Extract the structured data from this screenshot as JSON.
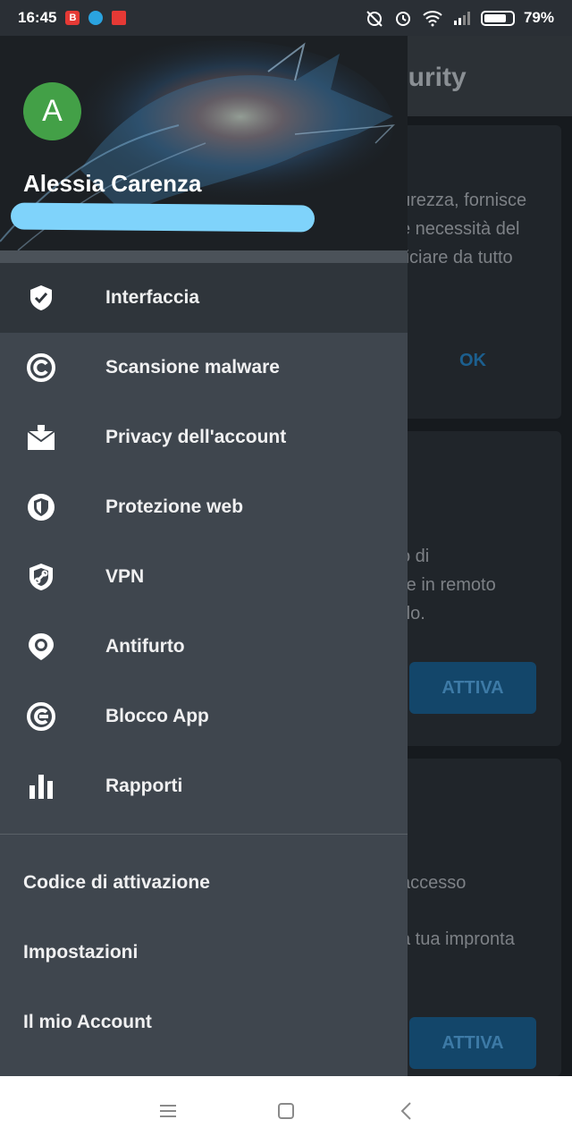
{
  "status_bar": {
    "time": "16:45",
    "notif_b": "B",
    "battery": "79%",
    "battery_level": 0.79
  },
  "background_app": {
    "title_partial": "curity",
    "card1_lines": [
      "urezza, fornisce",
      "e necessità del",
      "ficiare da tutto"
    ],
    "card1_button": "OK",
    "card2_lines": [
      "o di",
      "re in remoto",
      "rlo."
    ],
    "card2_button": "ATTIVA",
    "card3_lines": [
      "accesso",
      "a tua impronta"
    ],
    "card3_button": "ATTIVA"
  },
  "drawer": {
    "avatar_letter": "A",
    "user_name": "Alessia Carenza",
    "menu": [
      {
        "label": "Interfaccia",
        "icon": "shield-check-icon",
        "active": true
      },
      {
        "label": "Scansione malware",
        "icon": "scan-icon",
        "active": false
      },
      {
        "label": "Privacy dell'account",
        "icon": "mail-privacy-icon",
        "active": false
      },
      {
        "label": "Protezione web",
        "icon": "web-shield-icon",
        "active": false
      },
      {
        "label": "VPN",
        "icon": "vpn-shield-icon",
        "active": false
      },
      {
        "label": "Antifurto",
        "icon": "location-pin-icon",
        "active": false
      },
      {
        "label": "Blocco App",
        "icon": "app-lock-icon",
        "active": false
      },
      {
        "label": "Rapporti",
        "icon": "bar-chart-icon",
        "active": false
      }
    ],
    "bottom_items": [
      "Codice di attivazione",
      "Impostazioni",
      "Il mio Account"
    ]
  },
  "colors": {
    "drawer_bg": "#3f464e",
    "active_bg": "#2f353b",
    "avatar_green": "#43a047",
    "redact_blue": "#7fd3fb",
    "button_blue": "#13466a"
  }
}
